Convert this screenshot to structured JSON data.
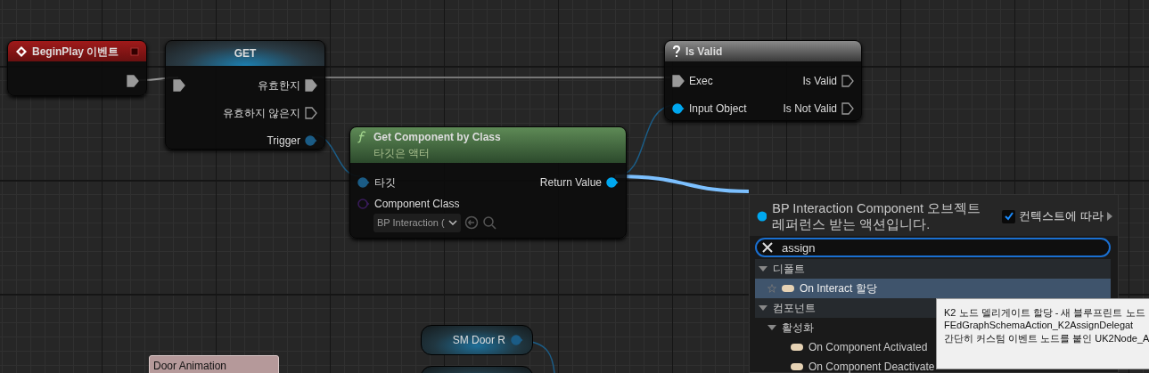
{
  "nodes": [
    {
      "kind": "event",
      "title": "BeginPlay 이벤트",
      "outputs": [
        {
          "kind": "exec",
          "connected": true
        }
      ]
    },
    {
      "kind": "macro",
      "title": "GET",
      "inputs": [
        {
          "kind": "exec",
          "connected": true
        }
      ],
      "outputs": [
        {
          "kind": "exec",
          "label": "유효한지",
          "connected": true
        },
        {
          "kind": "exec",
          "label": "유효하지 않은지",
          "connected": false
        },
        {
          "kind": "data",
          "label": "Trigger",
          "connected": true,
          "color": "#1b5c86"
        }
      ]
    },
    {
      "kind": "function",
      "title": "Get Component by Class",
      "subtitle": "타깃은 액터",
      "inputs": [
        {
          "kind": "data",
          "label": "타깃",
          "connected": true,
          "color": "#1b5c86"
        },
        {
          "kind": "class",
          "label": "Component Class",
          "connected": false,
          "color": "#3a1c5c",
          "value": "BP Interaction ("
        }
      ],
      "outputs": [
        {
          "kind": "data",
          "label": "Return Value",
          "connected": true,
          "color": "#00a8f0"
        }
      ]
    },
    {
      "kind": "branch",
      "title": "Is Valid",
      "inputs": [
        {
          "kind": "exec",
          "label": "Exec",
          "connected": true
        },
        {
          "kind": "data",
          "label": "Input Object",
          "connected": true,
          "color": "#00a8f0"
        }
      ],
      "outputs": [
        {
          "kind": "exec",
          "label": "Is Valid",
          "connected": false
        },
        {
          "kind": "exec",
          "label": "Is Not Valid",
          "connected": false
        }
      ]
    },
    {
      "kind": "getter",
      "title": "SM Door R",
      "outputs": [
        {
          "kind": "data",
          "connected": true,
          "color": "#1b5c86"
        }
      ]
    },
    {
      "kind": "getter"
    },
    {
      "kind": "comment",
      "title": "Door Animation"
    }
  ],
  "action_menu": {
    "title": "BP Interaction Component 오브젝트 레퍼런스 받는 액션입니다.",
    "context_sensitive": {
      "label": "컨텍스트에 따라",
      "checked": true
    },
    "search": {
      "value": "assign"
    },
    "tree": [
      {
        "label": "디폴트",
        "expanded": true,
        "children": [
          {
            "label": "On Interact 할당",
            "selected": true
          }
        ]
      },
      {
        "label": "컴포넌트",
        "expanded": true,
        "children": [
          {
            "label": "활성화",
            "expanded": true,
            "children": [
              {
                "label": "On Component Activated",
                "selected": false
              },
              {
                "label": "On Component Deactivate",
                "selected": false
              }
            ]
          }
        ]
      }
    ]
  },
  "tooltip": {
    "lines": [
      "K2 노드 델리게이트 할당 - 새 블루프린트 노드",
      "FEdGraphSchemaAction_K2AssignDelegat",
      "간단히 커스텀 이벤트 노드를 붙인 UK2Node_A"
    ]
  }
}
